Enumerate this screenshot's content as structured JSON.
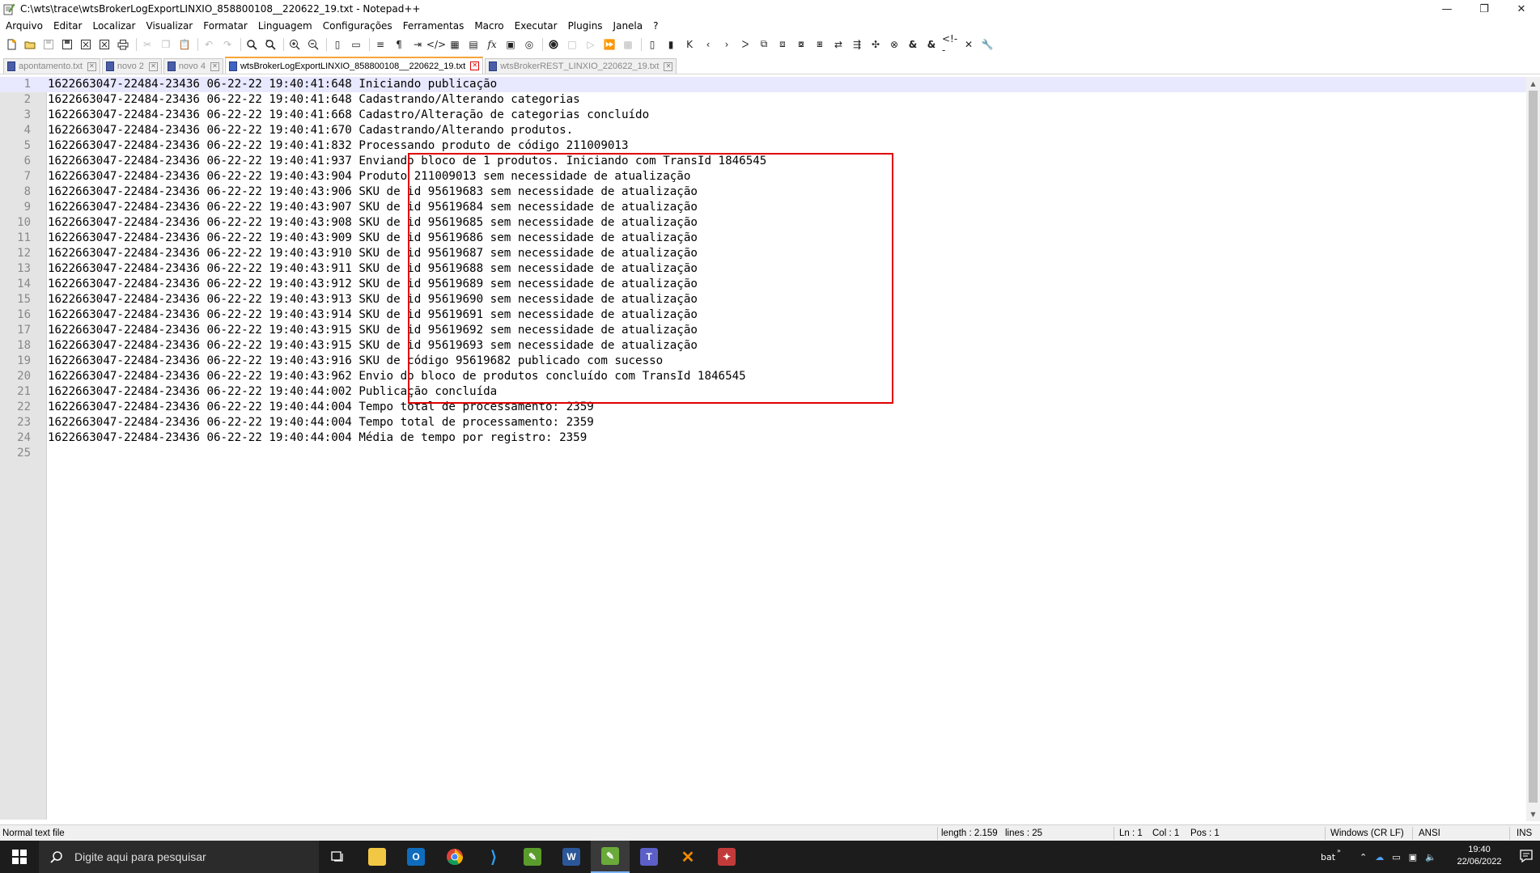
{
  "window": {
    "title": "C:\\wts\\trace\\wtsBrokerLogExportLINXIO_858800108__220622_19.txt - Notepad++",
    "controls": [
      "—",
      "❐",
      "✕"
    ]
  },
  "menu": [
    "Arquivo",
    "Editar",
    "Localizar",
    "Visualizar",
    "Formatar",
    "Linguagem",
    "Configurações",
    "Ferramentas",
    "Macro",
    "Executar",
    "Plugins",
    "Janela",
    "?"
  ],
  "tabs": [
    {
      "label": "apontamento.txt",
      "active": false
    },
    {
      "label": "novo 2",
      "active": false
    },
    {
      "label": "novo 4",
      "active": false
    },
    {
      "label": "wtsBrokerLogExportLINXIO_858800108__220622_19.txt",
      "active": true
    },
    {
      "label": "wtsBrokerREST_LINXIO_220622_19.txt",
      "active": false
    }
  ],
  "editor": {
    "lines": [
      "1622663047-22484-23436 06-22-22 19:40:41:648 Iniciando publicação",
      "1622663047-22484-23436 06-22-22 19:40:41:648 Cadastrando/Alterando categorias",
      "1622663047-22484-23436 06-22-22 19:40:41:668 Cadastro/Alteração de categorias concluído",
      "1622663047-22484-23436 06-22-22 19:40:41:670 Cadastrando/Alterando produtos.",
      "1622663047-22484-23436 06-22-22 19:40:41:832 Processando produto de código 211009013",
      "1622663047-22484-23436 06-22-22 19:40:41:937 Enviando bloco de 1 produtos. Iniciando com TransId 1846545",
      "1622663047-22484-23436 06-22-22 19:40:43:904 Produto 211009013 sem necessidade de atualização",
      "1622663047-22484-23436 06-22-22 19:40:43:906 SKU de id 95619683 sem necessidade de atualização",
      "1622663047-22484-23436 06-22-22 19:40:43:907 SKU de id 95619684 sem necessidade de atualização",
      "1622663047-22484-23436 06-22-22 19:40:43:908 SKU de id 95619685 sem necessidade de atualização",
      "1622663047-22484-23436 06-22-22 19:40:43:909 SKU de id 95619686 sem necessidade de atualização",
      "1622663047-22484-23436 06-22-22 19:40:43:910 SKU de id 95619687 sem necessidade de atualização",
      "1622663047-22484-23436 06-22-22 19:40:43:911 SKU de id 95619688 sem necessidade de atualização",
      "1622663047-22484-23436 06-22-22 19:40:43:912 SKU de id 95619689 sem necessidade de atualização",
      "1622663047-22484-23436 06-22-22 19:40:43:913 SKU de id 95619690 sem necessidade de atualização",
      "1622663047-22484-23436 06-22-22 19:40:43:914 SKU de id 95619691 sem necessidade de atualização",
      "1622663047-22484-23436 06-22-22 19:40:43:915 SKU de id 95619692 sem necessidade de atualização",
      "1622663047-22484-23436 06-22-22 19:40:43:915 SKU de id 95619693 sem necessidade de atualização",
      "1622663047-22484-23436 06-22-22 19:40:43:916 SKU de código 95619682 publicado com sucesso",
      "1622663047-22484-23436 06-22-22 19:40:43:962 Envio do bloco de produtos concluído com TransId 1846545",
      "1622663047-22484-23436 06-22-22 19:40:44:002 Publicação concluída",
      "1622663047-22484-23436 06-22-22 19:40:44:004 Tempo total de processamento: 2359",
      "1622663047-22484-23436 06-22-22 19:40:44:004 Tempo total de processamento: 2359",
      "1622663047-22484-23436 06-22-22 19:40:44:004 Média de tempo por registro: 2359",
      ""
    ],
    "current_line": 1,
    "highlight_color": "#e00000"
  },
  "status": {
    "file_type": "Normal text file",
    "length": "length : 2.159",
    "lines": "lines : 25",
    "ln": "Ln : 1",
    "col": "Col : 1",
    "pos": "Pos : 1",
    "eol": "Windows (CR LF)",
    "encoding": "ANSI",
    "mode": "INS"
  },
  "taskbar": {
    "search_placeholder": "Digite aqui para pesquisar",
    "tray_label": "bat",
    "time": "19:40",
    "date": "22/06/2022"
  },
  "colors": {
    "tab_active_accent": "#f9a33a",
    "taskbar_bg": "#1c1c1c",
    "current_line_bg": "#e8e8ff"
  }
}
